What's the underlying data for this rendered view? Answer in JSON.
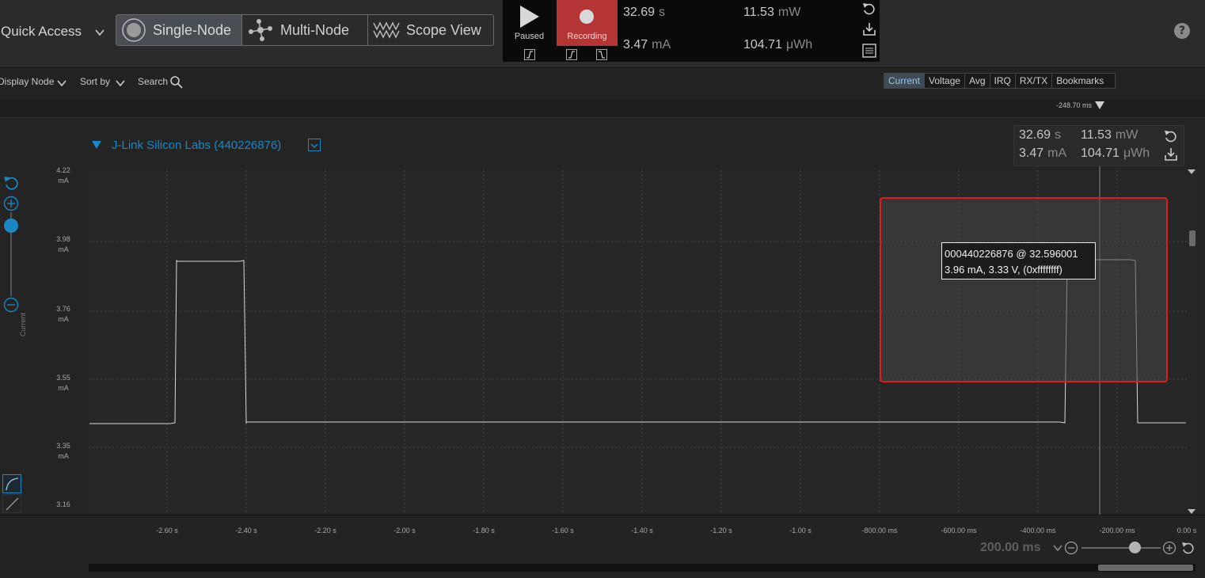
{
  "header": {
    "quick_access_label": "Quick Access",
    "modes": [
      {
        "label": "Single-Node",
        "active": true,
        "icon": "single-node-icon"
      },
      {
        "label": "Multi-Node",
        "active": false,
        "icon": "multi-node-icon"
      },
      {
        "label": "Scope View",
        "active": false,
        "icon": "scope-view-icon"
      }
    ],
    "paused_label": "Paused",
    "recording_label": "Recording",
    "stats": {
      "time_value": "32.69",
      "time_unit": "s",
      "current_value": "3.47",
      "current_unit": "mA",
      "power_value": "11.53",
      "power_unit": "mW",
      "energy_value": "104.71",
      "energy_unit": "μWh"
    },
    "help_glyph": "?"
  },
  "toolbar": {
    "display_node_label": "Display Node",
    "sort_by_label": "Sort by",
    "search_label": "Search",
    "tabs": [
      "Current",
      "Voltage",
      "Avg",
      "IRQ",
      "RX/TX",
      "Bookmarks"
    ],
    "active_tab": "Current",
    "cursor_time": "-248.70 ms"
  },
  "node": {
    "title": "J-Link Silicon Labs (440226876)",
    "stats": {
      "time_value": "32.69",
      "time_unit": "s",
      "current_value": "3.47",
      "current_unit": "mA",
      "power_value": "11.53",
      "power_unit": "mW",
      "energy_value": "104.71",
      "energy_unit": "μWh"
    }
  },
  "plot": {
    "y_axis_title": "Current",
    "y_ticks": [
      {
        "value": "4.22",
        "unit": "mA"
      },
      {
        "value": "3.98",
        "unit": "mA"
      },
      {
        "value": "3.76",
        "unit": "mA"
      },
      {
        "value": "3.55",
        "unit": "mA"
      },
      {
        "value": "3.35",
        "unit": "mA"
      },
      {
        "value": "3.16",
        "unit": ""
      }
    ],
    "x_ticks": [
      "-2.60 s",
      "-2.40 s",
      "-2.20 s",
      "-2.00 s",
      "-1.80 s",
      "-1.60 s",
      "-1.40 s",
      "-1.20 s",
      "-1.00 s",
      "-800.00 ms",
      "-600.00 ms",
      "-400.00 ms",
      "-200.00 ms",
      "0.00 s"
    ],
    "tooltip_line1": "000440226876 @ 32.596001",
    "tooltip_line2": "3.96 mA, 3.33 V, (0xffffffff)",
    "trace_color": "#d9d9d9",
    "selection_color": "#e21c1c"
  },
  "footer": {
    "zoom_value": "200.00 ms",
    "zoom_level": 0.7
  }
}
